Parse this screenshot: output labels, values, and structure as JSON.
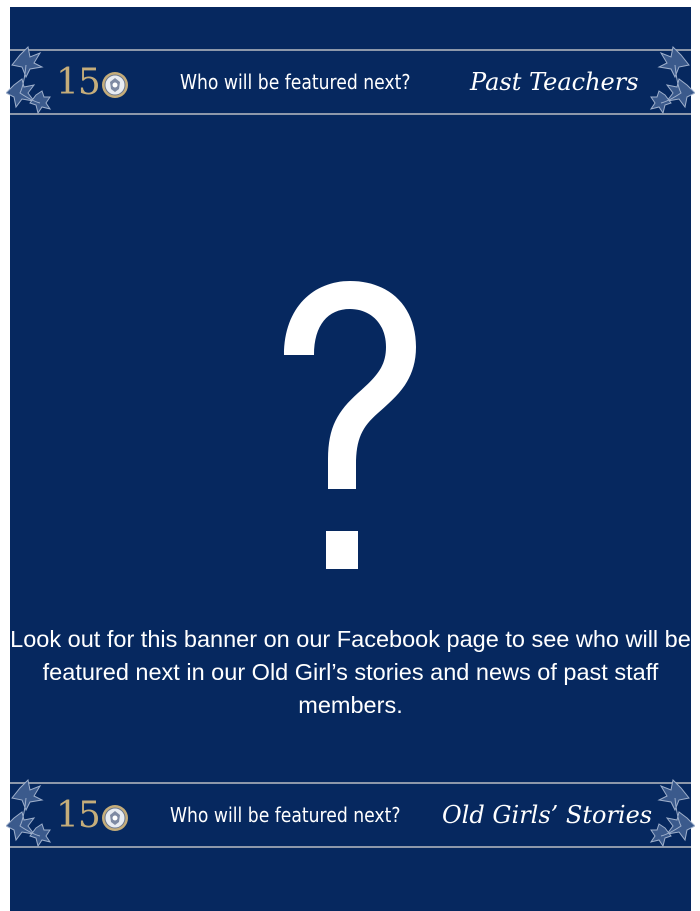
{
  "colors": {
    "background": "#06285f",
    "accent_gold": "#c5ad7a",
    "rule": "#8d98aa",
    "text": "#ffffff"
  },
  "top_banner": {
    "logo_number": "15",
    "tagline": "Who will be featured next?",
    "script_label": "Past Teachers",
    "icons": [
      "ivy-leaves-icon",
      "crest-seal-icon"
    ]
  },
  "main": {
    "symbol": "?",
    "message": "Look out for this banner on our Facebook page to see who will be featured next in our Old Girl’s stories and news of past staff members."
  },
  "bottom_banner": {
    "logo_number": "15",
    "tagline": "Who will be featured next?",
    "script_label": "Old Girls’ Stories",
    "icons": [
      "ivy-leaves-icon",
      "crest-seal-icon"
    ]
  }
}
